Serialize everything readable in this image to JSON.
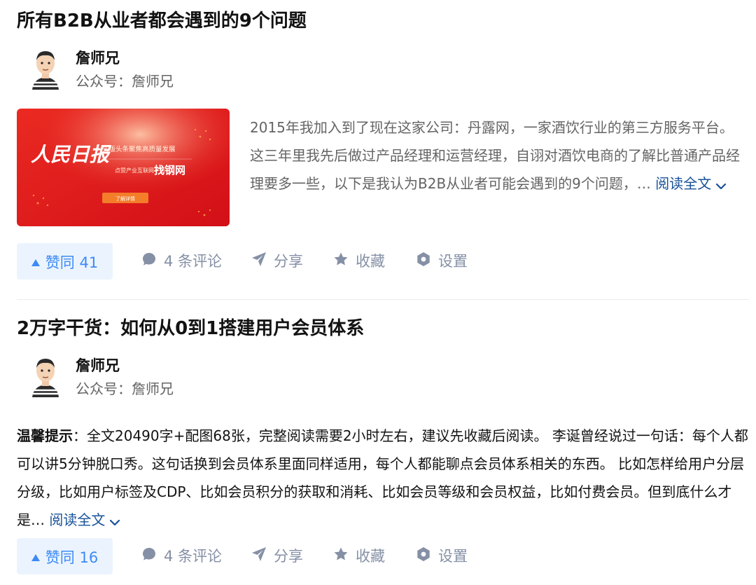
{
  "articles": [
    {
      "title": "所有B2B从业者都会遇到的9个问题",
      "author": {
        "name": "詹师兄",
        "desc": "公众号：詹师兄"
      },
      "thumbnail": {
        "logo_text": "人民日报",
        "line1": "头版头条聚焦高质量发展",
        "line2": "点赞产业互联网平台",
        "brand": "找钢网",
        "button": "了解详情"
      },
      "excerpt": "2015年我加入到了现在这家公司：丹露网，一家酒饮行业的第三方服务平台。 这三年里我先后做过产品经理和运营经理，自诩对酒饮电商的了解比普通产品经理要多一些，以下是我认为B2B从业者可能会遇到的9个问题，…",
      "read_more": "阅读全文",
      "vote_label": "赞同 41",
      "comment_label": "4 条评论",
      "share_label": "分享",
      "fav_label": "收藏",
      "settings_label": "设置"
    },
    {
      "title": "2万字干货：如何从0到1搭建用户会员体系",
      "author": {
        "name": "詹师兄",
        "desc": "公众号：詹师兄"
      },
      "excerpt_prefix": "温馨提示",
      "excerpt": "：全文20490字+配图68张，完整阅读需要2小时左右，建议先收藏后阅读。 李诞曾经说过一句话：每个人都可以讲5分钟脱口秀。这句话换到会员体系里面同样适用，每个人都能聊点会员体系相关的东西。 比如怎样给用户分层分级，比如用户标签及CDP、比如会员积分的获取和消耗、比如会员等级和会员权益，比如付费会员。但到底什么才是…",
      "read_more": "阅读全文",
      "vote_label": "赞同 16",
      "comment_label": "4 条评论",
      "share_label": "分享",
      "fav_label": "收藏",
      "settings_label": "设置"
    }
  ],
  "colors": {
    "accent": "#3d8af5",
    "vote_bg": "#ebf4fe",
    "link": "#175199",
    "muted": "#8590a6",
    "thumb_red": "#e3191b"
  },
  "icons": [
    "vote-up-icon",
    "comment-icon",
    "share-icon",
    "star-icon",
    "gear-icon",
    "chevron-down-icon"
  ]
}
